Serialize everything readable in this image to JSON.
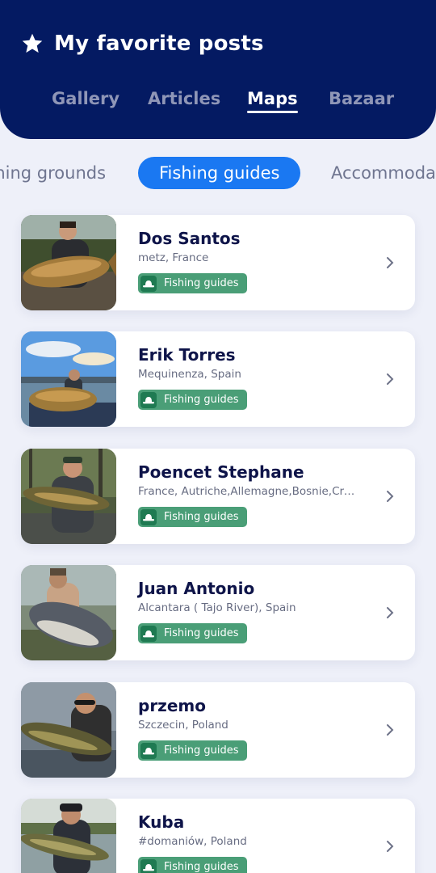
{
  "header": {
    "title": "My favorite posts",
    "title_icon": "star-icon",
    "tabs": [
      {
        "label": "Gallery",
        "active": false
      },
      {
        "label": "Articles",
        "active": false
      },
      {
        "label": "Maps",
        "active": true
      },
      {
        "label": "Bazaar",
        "active": false
      }
    ]
  },
  "categories": [
    {
      "label": "Fishing grounds",
      "active": false
    },
    {
      "label": "Fishing guides",
      "active": true
    },
    {
      "label": "Accommodation",
      "active": false
    }
  ],
  "guides": [
    {
      "name": "Dos Santos",
      "location": "metz, France",
      "badge": "Fishing guides"
    },
    {
      "name": "Erik Torres",
      "location": "Mequinenza, Spain",
      "badge": "Fishing guides"
    },
    {
      "name": "Poencet Stephane",
      "location": "France, Autriche,Allemagne,Bosnie,Croatie",
      "badge": "Fishing guides"
    },
    {
      "name": "Juan Antonio",
      "location": "Alcantara ( Tajo River), Spain",
      "badge": "Fishing guides"
    },
    {
      "name": "przemo",
      "location": "Szczecin, Poland",
      "badge": "Fishing guides"
    },
    {
      "name": "Kuba",
      "location": "#domaniów, Poland",
      "badge": "Fishing guides"
    }
  ],
  "colors": {
    "header_bg": "#041a62",
    "page_bg": "#eef0f9",
    "accent": "#1a78f2",
    "badge": "#4a9e77"
  }
}
